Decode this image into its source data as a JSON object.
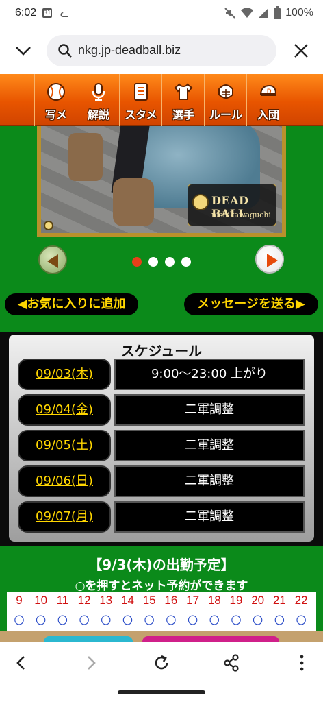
{
  "status": {
    "time": "6:02",
    "calendar_day": "31",
    "battery": "100%",
    "icons": [
      "mute-icon",
      "wifi-icon",
      "signal-icon",
      "battery-icon"
    ]
  },
  "browser": {
    "url": "nkg.jp-deadball.biz"
  },
  "nav": {
    "items": [
      {
        "label": "写メ",
        "icon": "baseball-icon"
      },
      {
        "label": "解説",
        "icon": "microphone-icon"
      },
      {
        "label": "スタメン",
        "icon": "lineup-sheet-icon"
      },
      {
        "label": "選手",
        "icon": "uniform-icon"
      },
      {
        "label": "ルール",
        "icon": "catcher-mask-icon"
      },
      {
        "label": "入団",
        "icon": "cap-icon"
      }
    ]
  },
  "banner": {
    "brand": "DEAD BALL",
    "location": "nishikawaguchi"
  },
  "carousel": {
    "active_index": 0,
    "count": 4
  },
  "actions": {
    "favorite": "◀お気に入りに追加",
    "message": "メッセージを送る▶"
  },
  "schedule": {
    "title": "スケジュール",
    "rows": [
      {
        "date": "09/03(木)",
        "value": "9:00〜23:00 上がり"
      },
      {
        "date": "09/04(金)",
        "value": "二軍調整"
      },
      {
        "date": "09/05(土)",
        "value": "二軍調整"
      },
      {
        "date": "09/06(日)",
        "value": "二軍調整"
      },
      {
        "date": "09/07(月)",
        "value": "二軍調整"
      }
    ]
  },
  "attendance": {
    "heading": "【9/3(木)の出勤予定】",
    "subheading": "○を押すとネット予約ができます",
    "hours": [
      "9",
      "10",
      "11",
      "12",
      "13",
      "14",
      "15",
      "16",
      "17",
      "18",
      "19",
      "20",
      "21",
      "22"
    ],
    "mark": "〇"
  },
  "colors": {
    "nav_orange": "#e85500",
    "field_green": "#0b8a1a",
    "accent_yellow": "#ffd600"
  }
}
